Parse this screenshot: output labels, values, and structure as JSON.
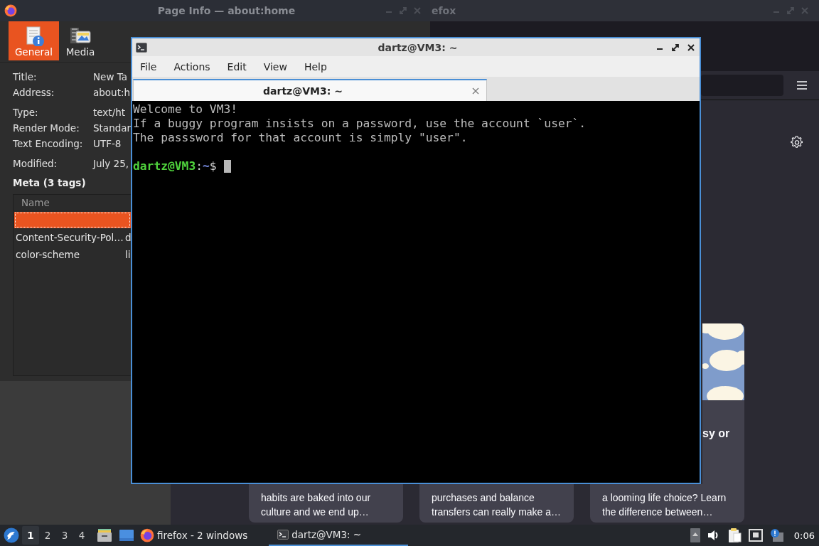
{
  "page_info": {
    "title": "Page Info — about:home",
    "tabs": [
      {
        "label": "General",
        "selected": true
      },
      {
        "label": "Media",
        "selected": false
      }
    ],
    "field_groups": [
      [
        {
          "label": "Title:",
          "value": "New Ta"
        },
        {
          "label": "Address:",
          "value": "about:h"
        }
      ],
      [
        {
          "label": "Type:",
          "value": "text/ht"
        },
        {
          "label": "Render Mode:",
          "value": "Standar"
        },
        {
          "label": "Text Encoding:",
          "value": "UTF-8"
        }
      ],
      [
        {
          "label": "Modified:",
          "value": "July 25,"
        }
      ]
    ],
    "meta_heading": "Meta (3 tags)",
    "meta_table": {
      "columns": [
        "Name"
      ],
      "rows": [
        {
          "selected": true
        },
        {
          "name": "Content-Security-Pol…",
          "column_2": "d",
          "selected": false
        },
        {
          "name": "color-scheme",
          "column_2": "li",
          "selected": false
        }
      ]
    }
  },
  "firefox": {
    "title": "efox",
    "cards": [
      {
        "lines": [
          "habits are baked into our",
          "culture and we end up…"
        ]
      },
      {
        "lines": [
          "purchases and balance",
          "transfers can really make a…"
        ]
      },
      {
        "headline": "sy or",
        "lines": [
          "a looming life choice? Learn",
          "the difference between…"
        ]
      }
    ]
  },
  "terminal": {
    "title": "dartz@VM3: ~",
    "menu": [
      "File",
      "Actions",
      "Edit",
      "View",
      "Help"
    ],
    "tabs": [
      {
        "label": "dartz@VM3: ~",
        "selected": true
      }
    ],
    "output": [
      "Welcome to VM3!",
      "If a buggy program insists on a password, use the account `user`.",
      "The passsword for that account is simply \"user\"."
    ],
    "prompt": {
      "user_host": "dartz@VM3",
      "separator": ":",
      "path": "~",
      "symbol": "$"
    }
  },
  "taskbar": {
    "workspaces": [
      {
        "label": "1",
        "selected": true
      },
      {
        "label": "2",
        "selected": false
      },
      {
        "label": "3",
        "selected": false
      },
      {
        "label": "4",
        "selected": false
      }
    ],
    "tasks": [
      {
        "kind": "browser",
        "label": "firefox - 2 windows",
        "selected": false
      },
      {
        "kind": "terminal",
        "label": "dartz@VM3: ~",
        "selected": true
      }
    ],
    "clock": "0:06"
  }
}
